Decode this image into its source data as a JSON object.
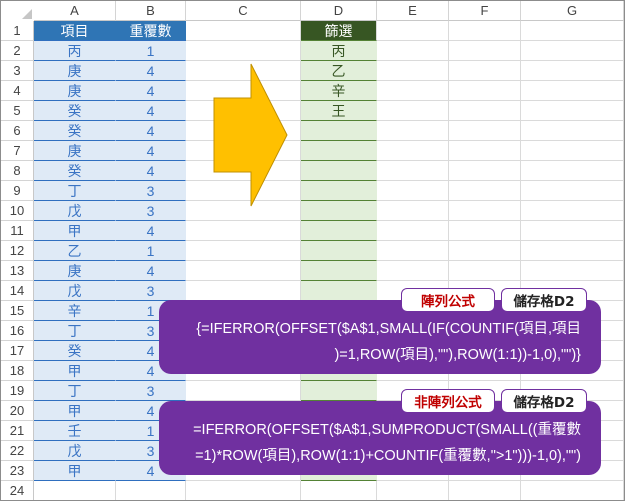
{
  "columns": [
    "A",
    "B",
    "C",
    "D",
    "E",
    "F",
    "G"
  ],
  "rows": [
    "1",
    "2",
    "3",
    "4",
    "5",
    "6",
    "7",
    "8",
    "9",
    "10",
    "11",
    "12",
    "13",
    "14",
    "15",
    "16",
    "17",
    "18",
    "19",
    "20",
    "21",
    "22",
    "23",
    "24"
  ],
  "headers": {
    "a1": "項目",
    "b1": "重覆數",
    "d1": "篩選"
  },
  "table": {
    "items": [
      "丙",
      "庚",
      "庚",
      "癸",
      "癸",
      "庚",
      "癸",
      "丁",
      "戊",
      "甲",
      "乙",
      "庚",
      "戊",
      "辛",
      "丁",
      "癸",
      "甲",
      "丁",
      "甲",
      "壬",
      "戊",
      "甲"
    ],
    "counts": [
      "1",
      "4",
      "4",
      "4",
      "4",
      "4",
      "4",
      "3",
      "3",
      "4",
      "1",
      "4",
      "3",
      "1",
      "3",
      "4",
      "4",
      "3",
      "4",
      "1",
      "3",
      "4"
    ]
  },
  "filter_results": [
    "丙",
    "乙",
    "辛",
    "王"
  ],
  "panel1": {
    "tag_type": "陣列公式",
    "tag_cell": "儲存格D2",
    "line1": "{=IFERROR(OFFSET($A$1,SMALL(IF(COUNTIF(項目,項目",
    "line2": ")=1,ROW(項目),\"\"),ROW(1:1))-1,0),\"\")}"
  },
  "panel2": {
    "tag_type": "非陣列公式",
    "tag_cell": "儲存格D2",
    "line1": "=IFERROR(OFFSET($A$1,SUMPRODUCT(SMALL((重覆數",
    "line2": "=1)*ROW(項目),ROW(1:1)+COUNTIF(重覆數,\">1\")))-1,0),\"\")"
  },
  "colors": {
    "header_blue": "#2f75b5",
    "cell_blue": "#dfeaf6",
    "header_green": "#375623",
    "cell_green": "#e2efda",
    "panel_purple": "#7030a0",
    "arrow_fill": "#ffc000",
    "tag_red": "#c00000"
  },
  "icons": {
    "corner": "select-all-triangle-icon",
    "arrow": "right-arrow-shape"
  }
}
